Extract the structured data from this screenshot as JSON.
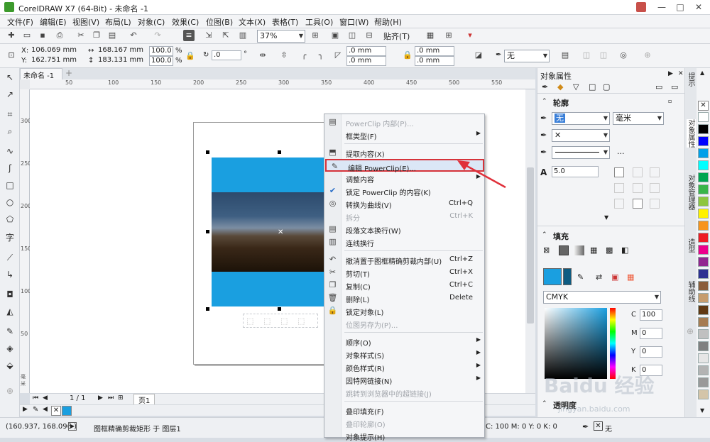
{
  "window": {
    "title": "CorelDRAW X7 (64-Bit) - 未命名 -1",
    "min": "—",
    "max": "□",
    "close": "✕"
  },
  "menu": [
    "文件(F)",
    "编辑(E)",
    "视图(V)",
    "布局(L)",
    "对象(C)",
    "效果(C)",
    "位图(B)",
    "文本(X)",
    "表格(T)",
    "工具(O)",
    "窗口(W)",
    "帮助(H)"
  ],
  "stdbar": {
    "zoom": "37%",
    "snap": "贴齐(T)"
  },
  "propbar": {
    "x_label": "X:",
    "x": "106.069 mm",
    "y_label": "Y:",
    "y": "162.751 mm",
    "w": "168.167 mm",
    "h": "183.131 mm",
    "sx": "100.0",
    "sy": "100.0",
    "pct": "%",
    "rot": ".0",
    "deg": "°",
    "c1": ".0 mm",
    "c2": ".0 mm",
    "c3": ".0 mm",
    "c4": ".0 mm",
    "outline": "无"
  },
  "doc": {
    "tab": "未命名 -1",
    "add": "+"
  },
  "ruler": {
    "h": [
      "50",
      "100",
      "150",
      "200",
      "250",
      "300",
      "350",
      "400",
      "450",
      "500",
      "550"
    ],
    "v": [
      "300",
      "250",
      "200",
      "150",
      "100",
      "50"
    ],
    "unit": "毫米"
  },
  "pagebar": {
    "pages": "1 / 1",
    "page": "页1"
  },
  "status": {
    "coords": "(160.937, 168.096 )",
    "desc": "图框精确剪裁矩形 于 图层1",
    "color": "C: 100 M: 0 Y: 0 K: 0",
    "fill": "无"
  },
  "docker": {
    "title": "对象属性",
    "outline": "轮廓",
    "outline_color": "无",
    "unit": "毫米",
    "miter": "5.0",
    "more": "...",
    "fill": "填充",
    "model": "CMYK",
    "c_label": "C",
    "c": "100",
    "m_label": "M",
    "m": "0",
    "y_label": "Y",
    "y": "0",
    "k_label": "K",
    "k": "0",
    "transparency": "透明度"
  },
  "dockertabs": [
    "提示",
    "对象属性",
    "对象管理器",
    "造型",
    "辅助线"
  ],
  "palette": [
    "#ffffff",
    "#000000",
    "#0000ff",
    "#00a0e9",
    "#00ffff",
    "#00a651",
    "#39b54a",
    "#8dc63f",
    "#fff200",
    "#f7941d",
    "#ed1c24",
    "#ec008c",
    "#92278f",
    "#2e3192",
    "#8b5e3c",
    "#c69c6d",
    "#603913",
    "#a67c52",
    "#c0c0c0",
    "#808080",
    "#e6e6e6",
    "#b3b3b3",
    "#999999",
    "#d4c5a9"
  ],
  "context_menu": {
    "items": [
      {
        "label": "PowerClip 内部(P)...",
        "disabled": true,
        "icon": "powerclip-inside-icon"
      },
      {
        "label": "框类型(F)",
        "sub": true
      },
      {
        "sep": true
      },
      {
        "label": "提取内容(X)",
        "icon": "extract-content-icon"
      },
      {
        "label": "编辑 PowerClip(E)...",
        "highlight": true,
        "icon": "edit-powerclip-icon"
      },
      {
        "label": "调整内容",
        "sub": true
      },
      {
        "label": "锁定 PowerClip 的内容(K)",
        "icon": "check-icon"
      },
      {
        "label": "转换为曲线(V)",
        "sc": "Ctrl+Q",
        "icon": "convert-curves-icon"
      },
      {
        "label": "拆分",
        "sc": "Ctrl+K",
        "disabled": true
      },
      {
        "label": "段落文本换行(W)",
        "icon": "text-wrap-icon"
      },
      {
        "label": "连线换行",
        "icon": "link-wrap-icon"
      },
      {
        "sep": true
      },
      {
        "label": "撤消置于图框精确剪裁内部(U)",
        "sc": "Ctrl+Z",
        "icon": "undo-icon"
      },
      {
        "label": "剪切(T)",
        "sc": "Ctrl+X",
        "icon": "scissors-icon"
      },
      {
        "label": "复制(C)",
        "sc": "Ctrl+C",
        "icon": "copy-icon"
      },
      {
        "label": "删除(L)",
        "sc": "Delete",
        "icon": "trash-icon"
      },
      {
        "label": "锁定对象(L)",
        "icon": "lock-icon"
      },
      {
        "label": "位图另存为(P)...",
        "disabled": true
      },
      {
        "sep": true
      },
      {
        "label": "顺序(O)",
        "sub": true
      },
      {
        "label": "对象样式(S)",
        "sub": true
      },
      {
        "label": "颜色样式(R)",
        "sub": true
      },
      {
        "label": "因特网链接(N)",
        "sub": true
      },
      {
        "label": "跳转到浏览器中的超链接(J)",
        "disabled": true
      },
      {
        "sep": true
      },
      {
        "label": "叠印填充(F)"
      },
      {
        "label": "叠印轮廓(O)",
        "disabled": true
      },
      {
        "label": "对象提示(H)"
      }
    ]
  },
  "watermark": "Baidu 经验",
  "watermark_url": "jingyan.baidu.com"
}
